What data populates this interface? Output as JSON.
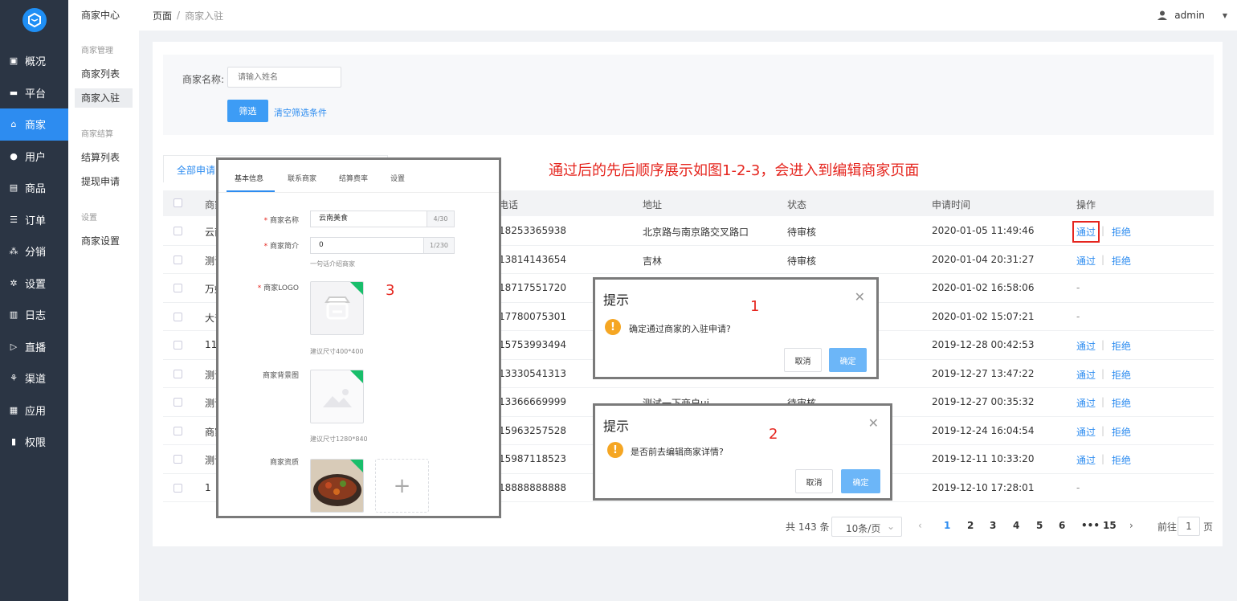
{
  "nav": {
    "items": [
      {
        "label": "概况",
        "icon": "chart-icon"
      },
      {
        "label": "平台",
        "icon": "monitor-icon"
      },
      {
        "label": "商家",
        "icon": "store-icon",
        "active": true
      },
      {
        "label": "用户",
        "icon": "user-icon"
      },
      {
        "label": "商品",
        "icon": "goods-icon"
      },
      {
        "label": "订单",
        "icon": "order-icon"
      },
      {
        "label": "分销",
        "icon": "distribution-icon"
      },
      {
        "label": "设置",
        "icon": "gear-icon"
      },
      {
        "label": "日志",
        "icon": "log-icon"
      },
      {
        "label": "直播",
        "icon": "live-icon"
      },
      {
        "label": "渠道",
        "icon": "channel-icon"
      },
      {
        "label": "应用",
        "icon": "apps-icon"
      },
      {
        "label": "权限",
        "icon": "lock-icon"
      }
    ]
  },
  "subnav": {
    "header": "商家中心",
    "g1": "商家管理",
    "i1": "商家列表",
    "i2": "商家入驻",
    "g2": "商家结算",
    "i3": "结算列表",
    "i4": "提现申请",
    "g3": "设置",
    "i5": "商家设置"
  },
  "breadcrumb": {
    "root": "页面",
    "sep": "/",
    "current": "商家入驻"
  },
  "user": {
    "name": "admin"
  },
  "filter": {
    "label": "商家名称:",
    "placeholder": "请输入姓名",
    "submit": "筛选",
    "clear": "清空筛选条件"
  },
  "tabs": {
    "all": "全部申请"
  },
  "annotation": "通过后的先后顺序展示如图1-2-3，会进入到编辑商家页面",
  "table": {
    "headers": {
      "name": "商家",
      "phone": "电话",
      "address": "地址",
      "status": "状态",
      "time": "申请时间",
      "ops": "操作"
    },
    "rows": [
      {
        "name": "云南",
        "phone": "18253365938",
        "address": "北京路与南京路交叉路口",
        "status": "待审核",
        "time": "2020-01-05 11:49:46",
        "ops": true
      },
      {
        "name": "测试",
        "phone": "13814143654",
        "address": "吉林",
        "status": "待审核",
        "time": "2020-01-04 20:31:27",
        "ops": true
      },
      {
        "name": "万好",
        "phone": "18717551720",
        "address": "",
        "status": "",
        "time": "2020-01-02 16:58:06",
        "ops": false
      },
      {
        "name": "大千",
        "phone": "17780075301",
        "address": "",
        "status": "",
        "time": "2020-01-02 15:07:21",
        "ops": false
      },
      {
        "name": "11",
        "phone": "15753993494",
        "address": "",
        "status": "",
        "time": "2019-12-28 00:42:53",
        "ops": true
      },
      {
        "name": "测试",
        "phone": "13330541313",
        "address": "",
        "status": "",
        "time": "2019-12-27 13:47:22",
        "ops": true
      },
      {
        "name": "测试",
        "phone": "13366669999",
        "address": "测试一下商户ui",
        "status": "待审核",
        "time": "2019-12-27 00:35:32",
        "ops": true
      },
      {
        "name": "商家",
        "phone": "15963257528",
        "address": "",
        "status": "",
        "time": "2019-12-24 16:04:54",
        "ops": true
      },
      {
        "name": "测试",
        "phone": "15987118523",
        "address": "",
        "status": "",
        "time": "2019-12-11 10:33:20",
        "ops": true
      },
      {
        "name": "1",
        "phone": "18888888888",
        "address": "",
        "status": "",
        "time": "2019-12-10 17:28:01",
        "ops": false
      }
    ],
    "approve": "通过",
    "reject": "拒绝",
    "divider": "|",
    "dash": "-"
  },
  "pager": {
    "total": "共 143 条",
    "size": "10条/页",
    "pages": [
      "1",
      "2",
      "3",
      "4",
      "5",
      "6",
      "•••",
      "15"
    ],
    "goto": "前往",
    "goto_val": "1",
    "page": "页"
  },
  "dialog1": {
    "title": "提示",
    "msg": "确定通过商家的入驻申请?",
    "cancel": "取消",
    "ok": "确定",
    "num": "1"
  },
  "dialog2": {
    "title": "提示",
    "msg": "是否前去编辑商家详情?",
    "cancel": "取消",
    "ok": "确定",
    "num": "2"
  },
  "form": {
    "num": "3",
    "tabs": [
      "基本信息",
      "联系商家",
      "结算费率",
      "设置"
    ],
    "name_label": "商家名称",
    "name_val": "云南美食",
    "name_cnt": "4/30",
    "intro_label": "商家简介",
    "intro_val": "0",
    "intro_cnt": "1/230",
    "intro_hint": "一句话介绍商家",
    "logo_label": "商家LOGO",
    "logo_hint": "建议尺寸400*400",
    "bg_label": "商家背景图",
    "bg_hint": "建议尺寸1280*840",
    "qual_label": "商家资质",
    "add": "+"
  }
}
